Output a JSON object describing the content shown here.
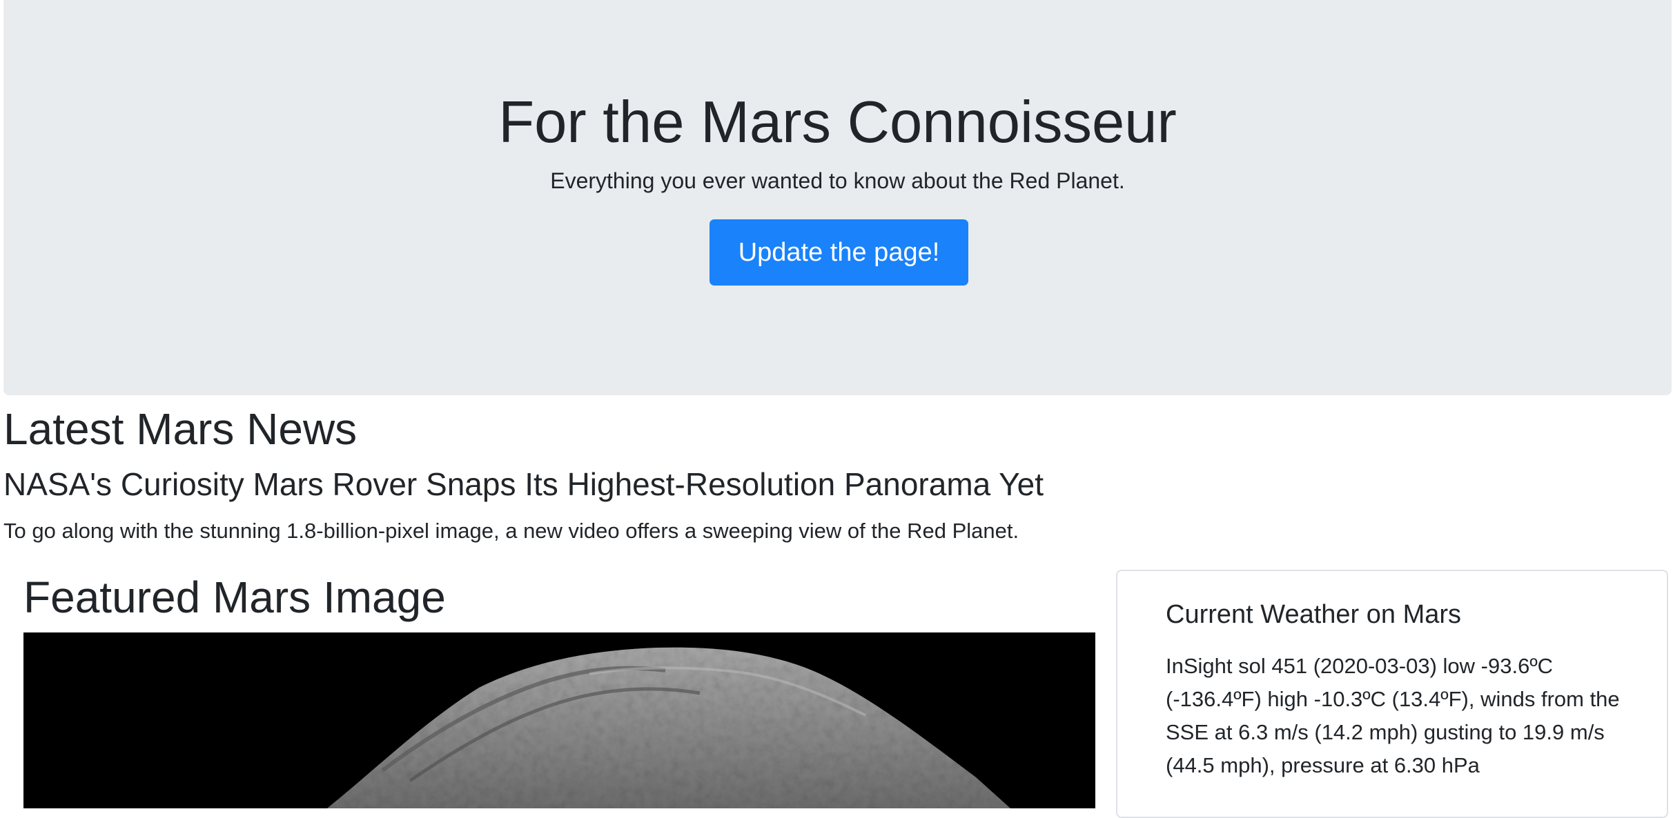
{
  "hero": {
    "title": "For the Mars Connoisseur",
    "subtitle": "Everything you ever wanted to know about the Red Planet.",
    "button_label": "Update the page!"
  },
  "news": {
    "section_title": "Latest Mars News",
    "headline": "NASA's Curiosity Mars Rover Snaps Its Highest-Resolution Panorama Yet",
    "teaser": "To go along with the stunning 1.8-billion-pixel image, a new video offers a sweeping view of the Red Planet."
  },
  "featured": {
    "section_title": "Featured Mars Image"
  },
  "weather": {
    "title": "Current Weather on Mars",
    "text": "InSight sol 451 (2020-03-03) low -93.6ºC (-136.4ºF) high -10.3ºC (13.4ºF), winds from the SSE at 6.3 m/s (14.2 mph) gusting to 19.9 m/s (44.5 mph), pressure at 6.30 hPa"
  },
  "colors": {
    "jumbotron_bg": "#e9ecef",
    "button_bg": "#1a82fb",
    "text": "#212529",
    "card_border": "#dee2e6"
  }
}
